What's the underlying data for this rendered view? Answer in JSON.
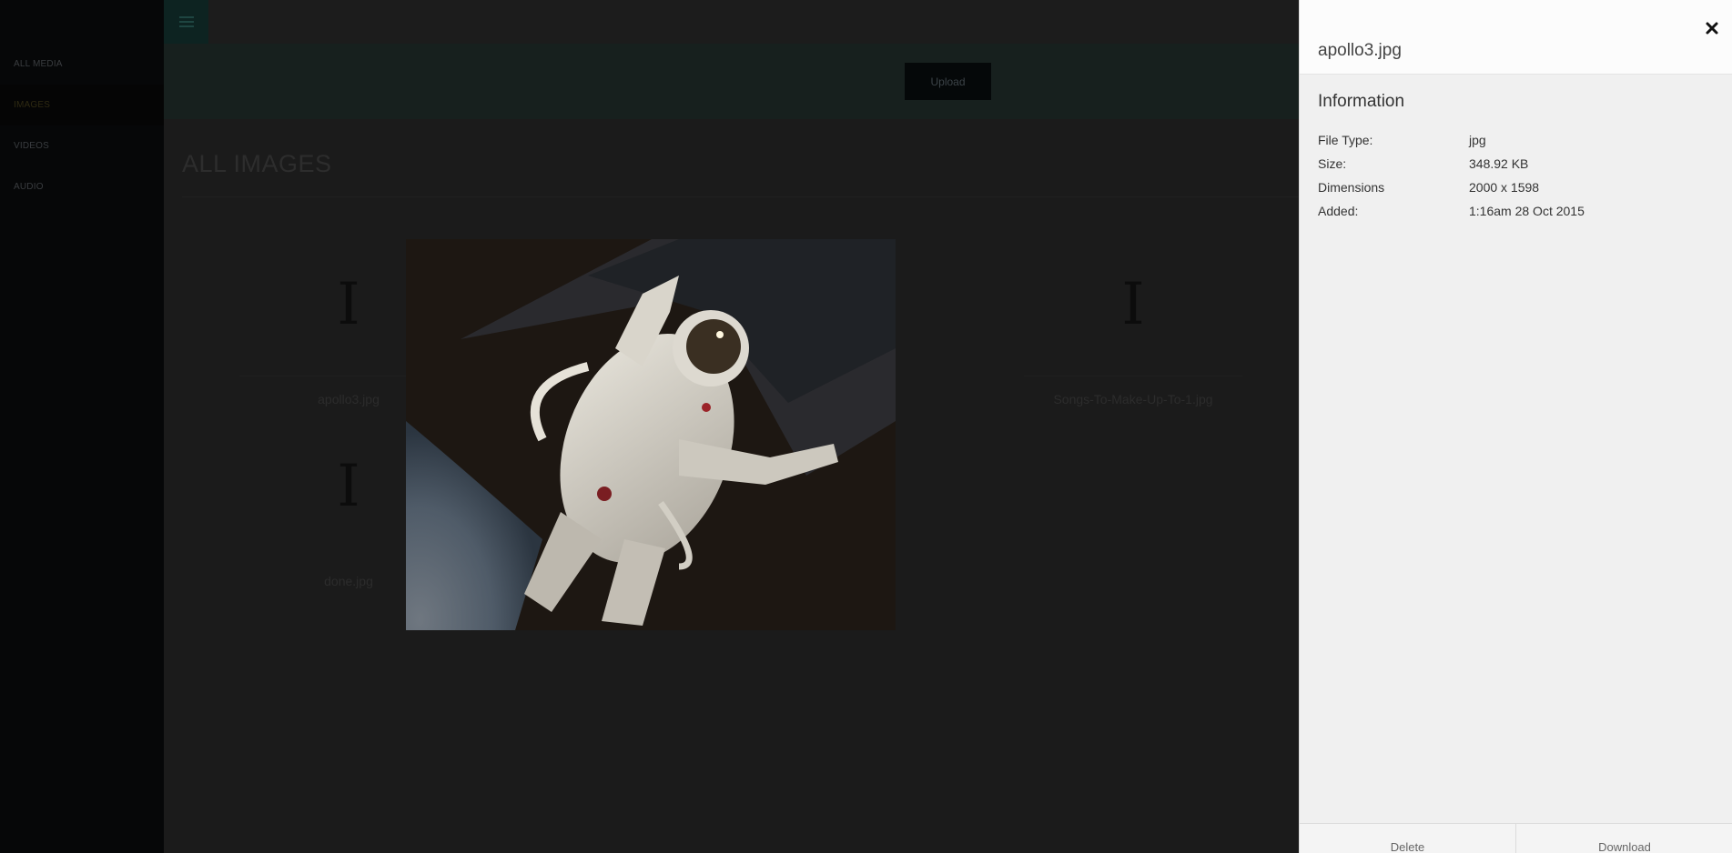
{
  "sidebar": {
    "items": [
      {
        "label": "ALL MEDIA"
      },
      {
        "label": "IMAGES"
      },
      {
        "label": "VIDEOS"
      },
      {
        "label": "AUDIO"
      }
    ]
  },
  "toolbar": {
    "upload_label": "Upload",
    "menu_icon": "hamburger-icon"
  },
  "main": {
    "title": "ALL IMAGES",
    "tiles": [
      {
        "icon": "I",
        "name": "apollo3.jpg"
      },
      {
        "icon": "I",
        "name": "Songs-To-Make-Up-To-1.jpg"
      },
      {
        "icon": "I",
        "name": "done.jpg"
      }
    ]
  },
  "panel": {
    "title": "apollo3.jpg",
    "heading": "Information",
    "rows": [
      {
        "key": "File Type:",
        "value": "jpg"
      },
      {
        "key": "Size:",
        "value": "348.92 KB"
      },
      {
        "key": "Dimensions",
        "value": "2000 x 1598"
      },
      {
        "key": "Added:",
        "value": "1:16am 28 Oct 2015"
      }
    ],
    "delete_label": "Delete",
    "download_label": "Download",
    "close_icon": "close-icon"
  },
  "colors": {
    "overlay_dark": "#1b1b1b",
    "sidebar": "#060708",
    "accent_teal": "#0d2321",
    "panel_bg": "#f0f0f0"
  }
}
